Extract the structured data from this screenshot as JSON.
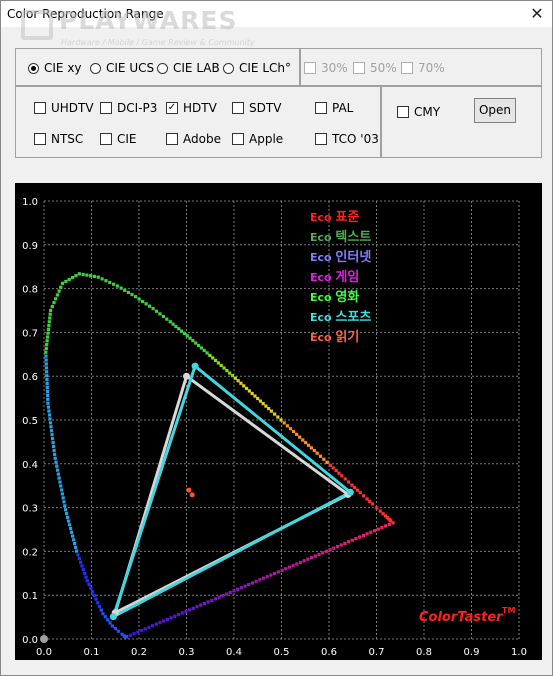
{
  "window": {
    "title": "Color Reproduction Range",
    "close_glyph": "✕"
  },
  "watermark": {
    "main": "PLAYWARES",
    "sub": "Hardware / Mobile / Game Review & Community"
  },
  "color_spaces": [
    {
      "label": "CIE xy",
      "selected": true
    },
    {
      "label": "CIE UCS",
      "selected": false
    },
    {
      "label": "CIE LAB",
      "selected": false
    },
    {
      "label": "CIE LCh°",
      "selected": false
    }
  ],
  "brightness": [
    {
      "label": "30%",
      "checked": false
    },
    {
      "label": "50%",
      "checked": false
    },
    {
      "label": "70%",
      "checked": false
    }
  ],
  "standards": [
    {
      "label": "UHDTV",
      "checked": false
    },
    {
      "label": "DCI-P3",
      "checked": false
    },
    {
      "label": "HDTV",
      "checked": true
    },
    {
      "label": "SDTV",
      "checked": false
    },
    {
      "label": "PAL",
      "checked": false
    },
    {
      "label": "NTSC",
      "checked": false
    },
    {
      "label": "CIE",
      "checked": false
    },
    {
      "label": "Adobe",
      "checked": false
    },
    {
      "label": "Apple",
      "checked": false
    },
    {
      "label": "TCO '03",
      "checked": false
    }
  ],
  "cmy": {
    "label": "CMY",
    "checked": false
  },
  "open_button": "Open",
  "check_glyph": "✓",
  "chart_data": {
    "type": "scatter",
    "xlim": [
      0.0,
      1.0
    ],
    "ylim": [
      0.0,
      1.0
    ],
    "x_ticks": [
      "0.0",
      "0.1",
      "0.2",
      "0.3",
      "0.4",
      "0.5",
      "0.6",
      "0.7",
      "0.8",
      "0.9",
      "1.0"
    ],
    "y_ticks": [
      "0.0",
      "0.1",
      "0.2",
      "0.3",
      "0.4",
      "0.5",
      "0.6",
      "0.7",
      "0.8",
      "0.9",
      "1.0"
    ],
    "grid": true,
    "legend_position": "top-right",
    "legend": [
      {
        "prefix": "Eco",
        "name": "표준",
        "color": "#ff2020"
      },
      {
        "prefix": "Eco",
        "name": "텍스트",
        "color": "#4caf50"
      },
      {
        "prefix": "Eco",
        "name": "인터넷",
        "color": "#8080ff"
      },
      {
        "prefix": "Eco",
        "name": "게임",
        "color": "#e020e0"
      },
      {
        "prefix": "Eco",
        "name": "영화",
        "color": "#40ff40"
      },
      {
        "prefix": "Eco",
        "name": "스포츠",
        "color": "#40e0e0"
      },
      {
        "prefix": "Eco",
        "name": "읽기",
        "color": "#ff6040"
      }
    ],
    "brand_text": "ColorTaster",
    "brand_tm": "TM",
    "spectral_locus": [
      [
        0.1741,
        0.005
      ],
      [
        0.1738,
        0.0049
      ],
      [
        0.1736,
        0.0049
      ],
      [
        0.1733,
        0.0048
      ],
      [
        0.1726,
        0.0048
      ],
      [
        0.1714,
        0.0051
      ],
      [
        0.1689,
        0.0069
      ],
      [
        0.1644,
        0.0109
      ],
      [
        0.1566,
        0.0177
      ],
      [
        0.144,
        0.0297
      ],
      [
        0.1241,
        0.0578
      ],
      [
        0.0913,
        0.1327
      ],
      [
        0.0687,
        0.2007
      ],
      [
        0.0454,
        0.295
      ],
      [
        0.0235,
        0.4127
      ],
      [
        0.0082,
        0.5384
      ],
      [
        0.0039,
        0.6548
      ],
      [
        0.0139,
        0.7502
      ],
      [
        0.0389,
        0.812
      ],
      [
        0.0743,
        0.8338
      ],
      [
        0.1142,
        0.8262
      ],
      [
        0.1547,
        0.8059
      ],
      [
        0.1929,
        0.7816
      ],
      [
        0.2296,
        0.7543
      ],
      [
        0.2658,
        0.7243
      ],
      [
        0.3016,
        0.6923
      ],
      [
        0.3373,
        0.6589
      ],
      [
        0.3731,
        0.6245
      ],
      [
        0.4087,
        0.5896
      ],
      [
        0.4441,
        0.5547
      ],
      [
        0.4788,
        0.5202
      ],
      [
        0.5125,
        0.4866
      ],
      [
        0.5448,
        0.4544
      ],
      [
        0.5752,
        0.4242
      ],
      [
        0.6029,
        0.3965
      ],
      [
        0.627,
        0.3725
      ],
      [
        0.6482,
        0.3514
      ],
      [
        0.6658,
        0.334
      ],
      [
        0.6801,
        0.3197
      ],
      [
        0.6915,
        0.3083
      ],
      [
        0.7006,
        0.2993
      ],
      [
        0.7079,
        0.292
      ],
      [
        0.714,
        0.2859
      ],
      [
        0.719,
        0.2809
      ],
      [
        0.723,
        0.277
      ],
      [
        0.726,
        0.274
      ],
      [
        0.7283,
        0.2717
      ],
      [
        0.73,
        0.27
      ],
      [
        0.7347,
        0.2653
      ]
    ],
    "hdtv_gamut": [
      [
        0.64,
        0.33
      ],
      [
        0.3,
        0.6
      ],
      [
        0.15,
        0.06
      ]
    ],
    "measured_gamut": [
      [
        0.645,
        0.335
      ],
      [
        0.318,
        0.623
      ],
      [
        0.146,
        0.051
      ]
    ],
    "white_points": [
      [
        0.305,
        0.34
      ],
      [
        0.312,
        0.329
      ]
    ],
    "origin_point": [
      0.0,
      0.0
    ]
  }
}
